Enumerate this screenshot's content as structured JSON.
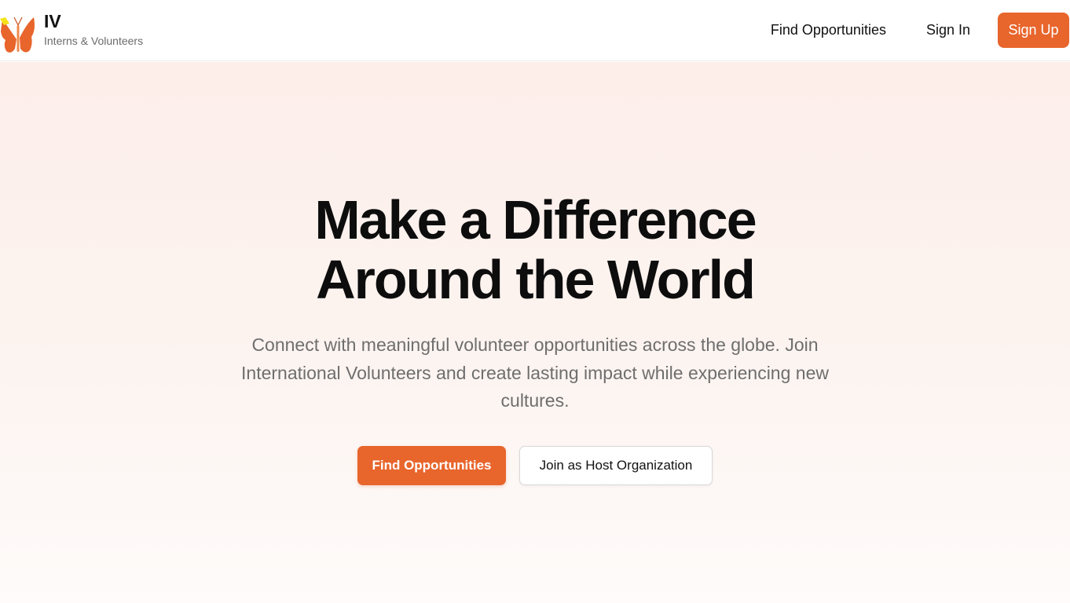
{
  "brand": {
    "name": "IV",
    "tagline": "Interns & Volunteers",
    "logo_icon": "butterfly-icon",
    "colors": {
      "accent": "#e8652c",
      "logo_highlight": "#f5e21a"
    }
  },
  "nav": {
    "find_opportunities": "Find Opportunities",
    "sign_in": "Sign In",
    "sign_up": "Sign Up"
  },
  "hero": {
    "title_line1": "Make a Difference",
    "title_line2": "Around the World",
    "description": "Connect with meaningful volunteer opportunities across the globe. Join International Volunteers and create lasting impact while experiencing new cultures.",
    "primary_cta": "Find Opportunities",
    "secondary_cta": "Join as Host Organization"
  }
}
